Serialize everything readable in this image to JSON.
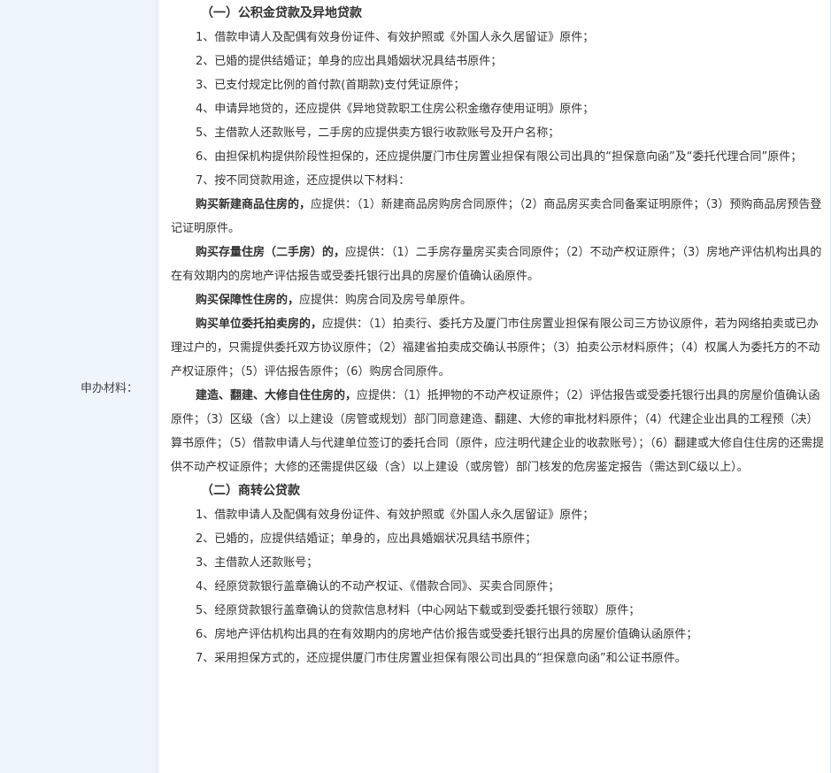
{
  "label": "申办材料：",
  "section1": {
    "title": "（一）公积金贷款及异地贷款",
    "items": [
      "1、借款申请人及配偶有效身份证件、有效护照或《外国人永久居留证》原件；",
      "2、已婚的提供结婚证；单身的应出具婚姻状况具结书原件；",
      "3、已支付规定比例的首付款(首期款)支付凭证原件；",
      "4、申请异地贷的，还应提供《异地贷款职工住房公积金缴存使用证明》原件；",
      "5、主借款人还款账号，二手房的应提供卖方银行收款账号及开户名称；",
      "6、由担保机构提供阶段性担保的，还应提供厦门市住房置业担保有限公司出具的“担保意向函”及“委托代理合同”原件；",
      "7、按不同贷款用途，还应提供以下材料："
    ],
    "purposes": [
      {
        "head": "购买新建商品住房的，",
        "text": "应提供：（1）新建商品房购房合同原件；（2）商品房买卖合同备案证明原件；（3）预购商品房预告登记证明原件。"
      },
      {
        "head": "购买存量住房（二手房）的，",
        "text": "应提供：（1）二手房存量房买卖合同原件；（2）不动产权证原件；（3）房地产评估机构出具的在有效期内的房地产评估报告或受委托银行出具的房屋价值确认函原件。"
      },
      {
        "head": "购买保障性住房的，",
        "text": "应提供：购房合同及房号单原件。"
      },
      {
        "head": "购买单位委托拍卖房的，",
        "text": "应提供：（1）拍卖行、委托方及厦门市住房置业担保有限公司三方协议原件，若为网络拍卖或已办理过户的，只需提供委托双方协议原件；（2）福建省拍卖成交确认书原件；（3）拍卖公示材料原件；（4）权属人为委托方的不动产权证原件；（5）评估报告原件；（6）购房合同原件。"
      },
      {
        "head": "建造、翻建、大修自住住房的，",
        "text": "应提供：（1）抵押物的不动产权证原件；（2）评估报告或受委托银行出具的房屋价值确认函原件；（3）区级（含）以上建设（房管或规划）部门同意建造、翻建、大修的审批材料原件；（4）代建企业出具的工程预（决）算书原件；（5）借款申请人与代建单位签订的委托合同（原件，应注明代建企业的收款账号）；（6）翻建或大修自住住房的还需提供不动产权证原件；大修的还需提供区级（含）以上建设（或房管）部门核发的危房鉴定报告（需达到C级以上）。"
      }
    ]
  },
  "section2": {
    "title": "（二）商转公贷款",
    "items": [
      "1、借款申请人及配偶有效身份证件、有效护照或《外国人永久居留证》原件；",
      "2、已婚的，应提供结婚证；单身的，应出具婚姻状况具结书原件；",
      "3、主借款人还款账号；",
      "4、经原贷款银行盖章确认的不动产权证、《借款合同》、买卖合同原件；",
      "5、经原贷款银行盖章确认的贷款信息材料（中心网站下载或到受委托银行领取）原件；",
      "6、房地产评估机构出具的在有效期内的房地产估价报告或受委托银行出具的房屋价值确认函原件；",
      "7、采用担保方式的，还应提供厦门市住房置业担保有限公司出具的“担保意向函”和公证书原件。"
    ]
  }
}
